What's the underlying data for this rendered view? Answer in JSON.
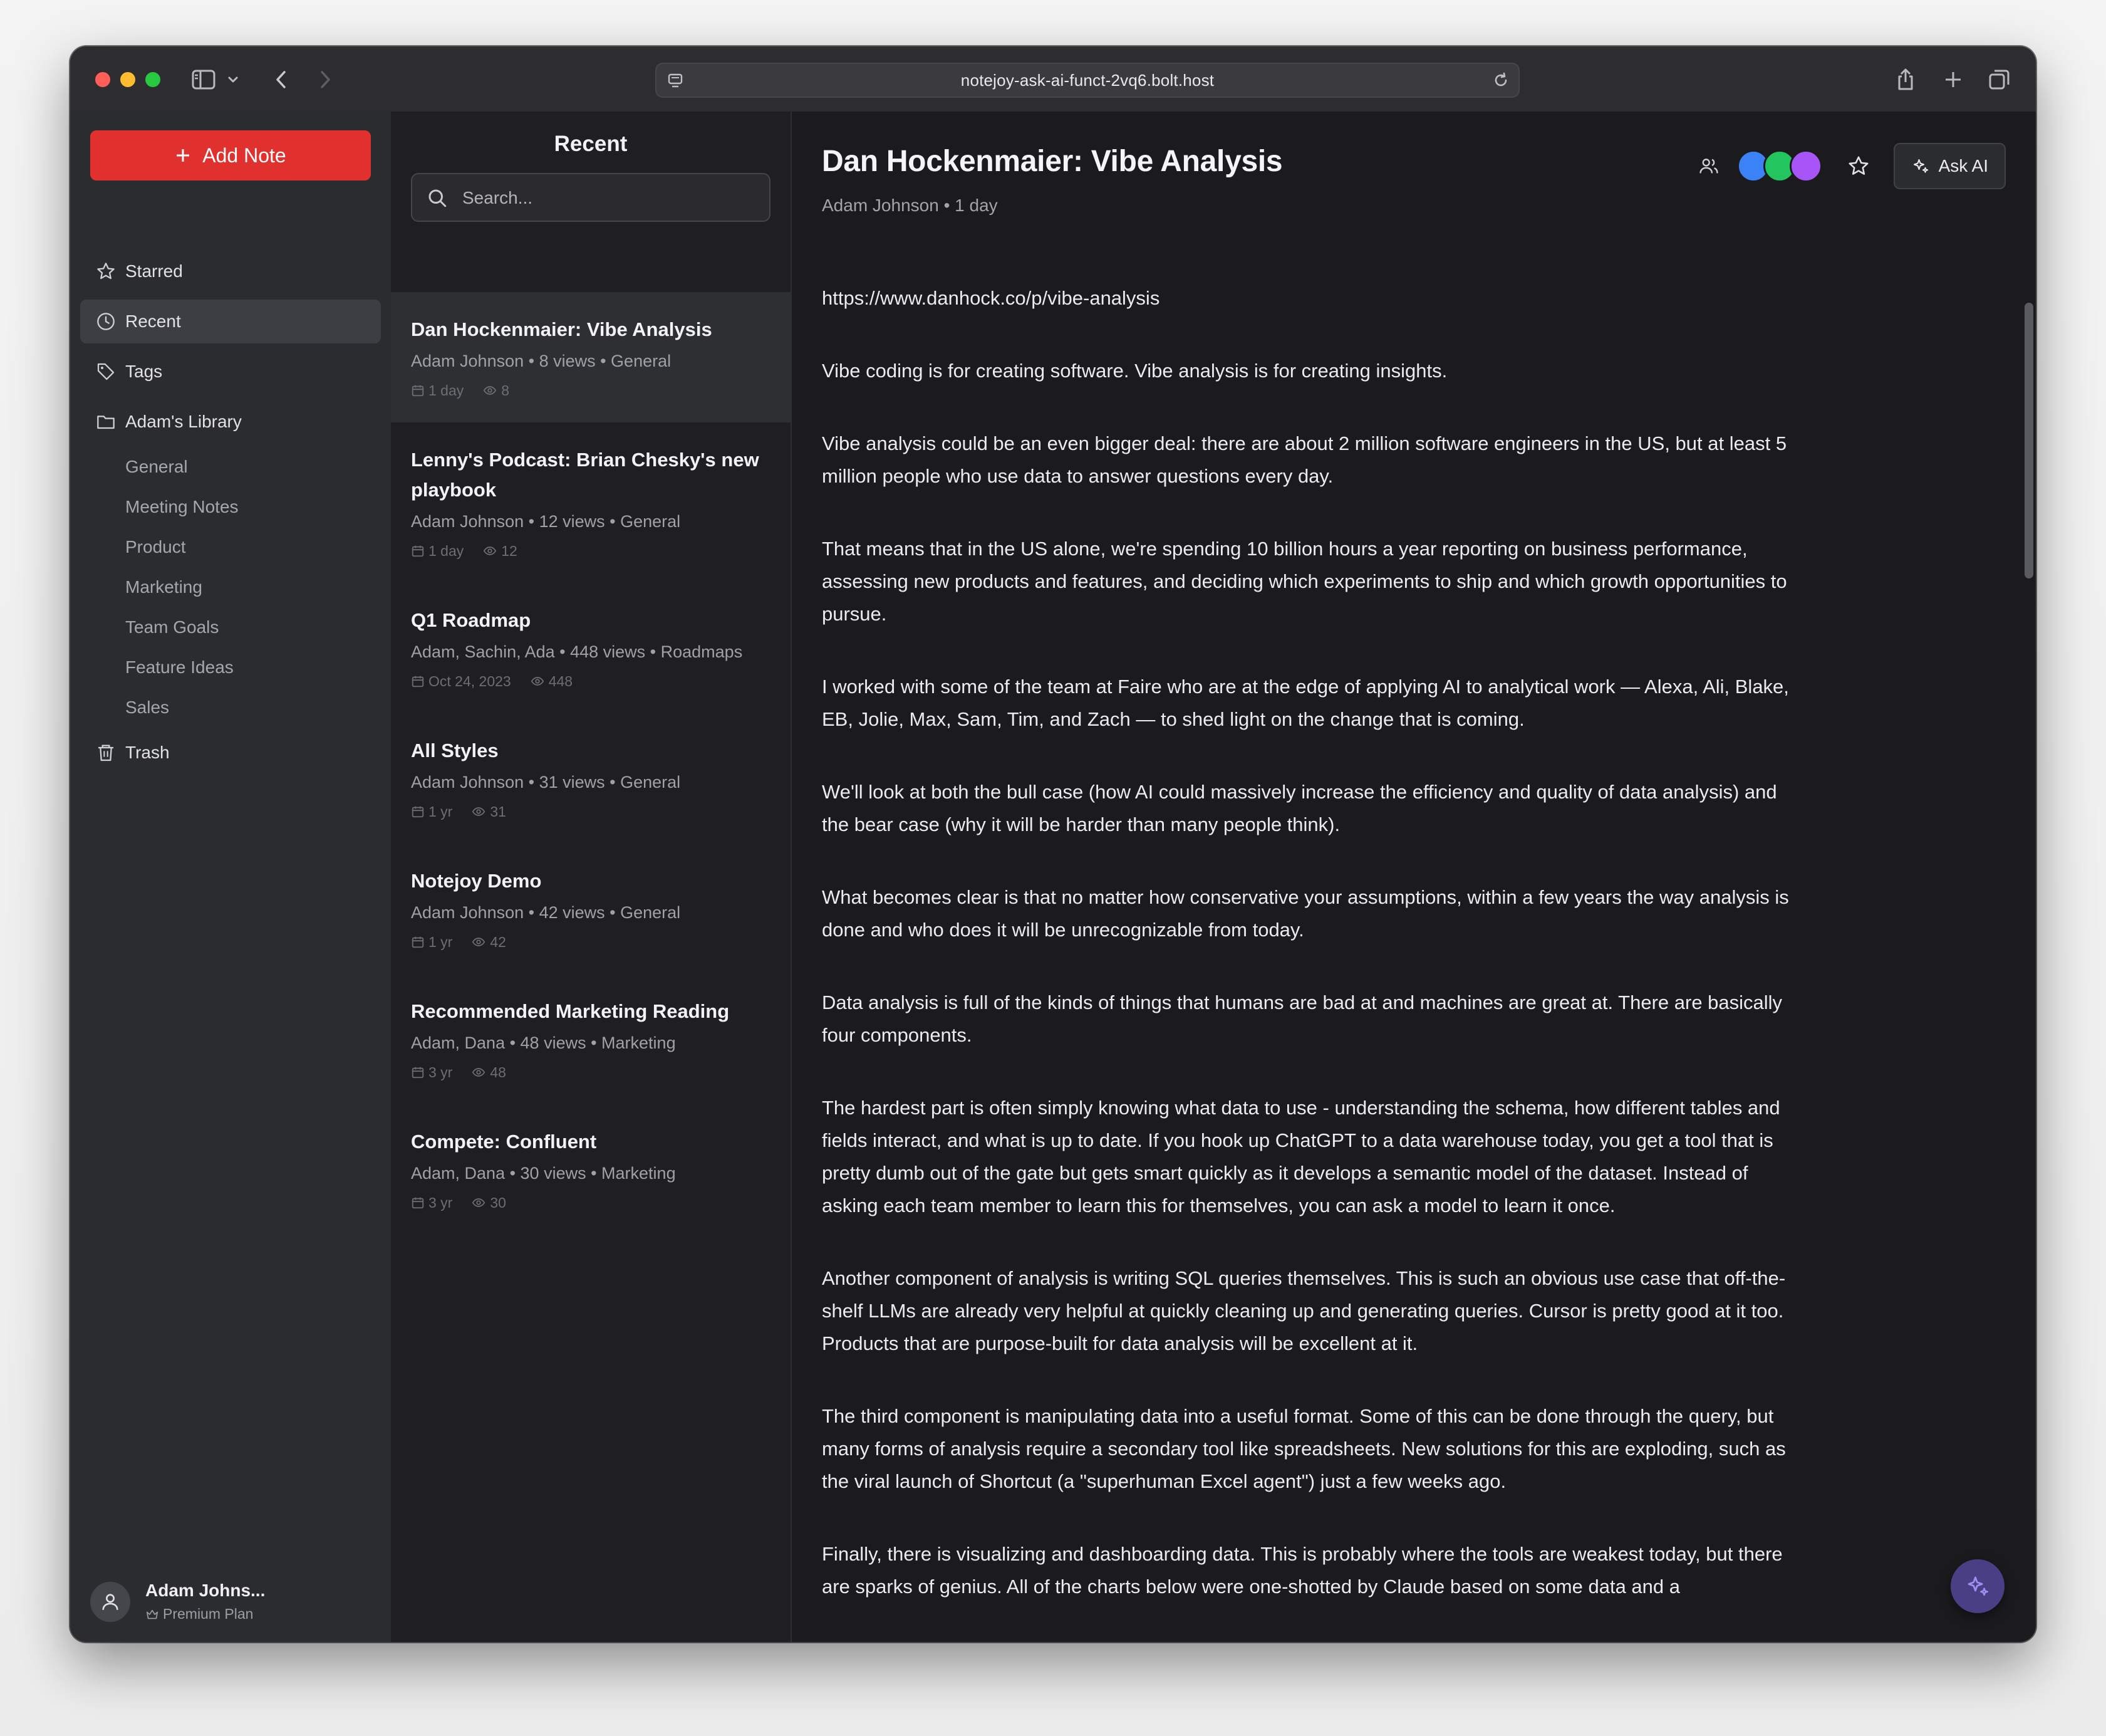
{
  "browser": {
    "url": "notejoy-ask-ai-funct-2vq6.bolt.host"
  },
  "sidebar": {
    "add_note_label": "Add Note",
    "nav": [
      {
        "label": "Starred",
        "icon": "star-icon"
      },
      {
        "label": "Recent",
        "icon": "clock-icon",
        "active": true
      },
      {
        "label": "Tags",
        "icon": "tag-icon"
      },
      {
        "label": "Adam's Library",
        "icon": "folder-icon"
      }
    ],
    "library": [
      "General",
      "Meeting Notes",
      "Product",
      "Marketing",
      "Team Goals",
      "Feature Ideas",
      "Sales"
    ],
    "trash_label": "Trash",
    "user": {
      "name": "Adam Johns...",
      "plan": "Premium Plan"
    }
  },
  "list": {
    "title": "Recent",
    "search_placeholder": "Search...",
    "notes": [
      {
        "title": "Dan Hockenmaier: Vibe Analysis",
        "meta": "Adam Johnson • 8 views • General",
        "age": "1 day",
        "views": "8",
        "selected": true
      },
      {
        "title": "Lenny's Podcast: Brian Chesky's new playbook",
        "meta": "Adam Johnson • 12 views • General",
        "age": "1 day",
        "views": "12"
      },
      {
        "title": "Q1 Roadmap",
        "meta": "Adam, Sachin, Ada • 448 views • Roadmaps",
        "age": "Oct 24, 2023",
        "views": "448"
      },
      {
        "title": "All Styles",
        "meta": "Adam Johnson • 31 views • General",
        "age": "1 yr",
        "views": "31"
      },
      {
        "title": "Notejoy Demo",
        "meta": "Adam Johnson • 42 views • General",
        "age": "1 yr",
        "views": "42"
      },
      {
        "title": "Recommended Marketing Reading",
        "meta": "Adam, Dana • 48 views • Marketing",
        "age": "3 yr",
        "views": "48"
      },
      {
        "title": "Compete: Confluent",
        "meta": "Adam, Dana • 30 views • Marketing",
        "age": "3 yr",
        "views": "30"
      }
    ]
  },
  "editor": {
    "title": "Dan Hockenmaier: Vibe Analysis",
    "meta": "Adam Johnson • 1 day",
    "ask_ai_label": "Ask AI",
    "collaborator_colors": [
      "#3b82f6",
      "#22c55e",
      "#a855f7"
    ],
    "paragraphs": [
      "https://www.danhock.co/p/vibe-analysis",
      "Vibe coding is for creating software. Vibe analysis is for creating insights.",
      "Vibe analysis could be an even bigger deal: there are about 2 million software engineers in the US, but at least 5 million people who use data to answer questions every day.",
      "That means that in the US alone, we're spending 10 billion hours a year reporting on business performance, assessing new products and features, and deciding which experiments to ship and which growth opportunities to pursue.",
      "I worked with some of the team at Faire who are at the edge of applying AI to analytical work — Alexa, Ali, Blake, EB, Jolie, Max, Sam, Tim, and Zach — to shed light on the change that is coming.",
      "We'll look at both the bull case (how AI could massively increase the efficiency and quality of data analysis) and the bear case (why it will be harder than many people think).",
      "What becomes clear is that no matter how conservative your assumptions, within a few years the way analysis is done and who does it will be unrecognizable from today.",
      "Data analysis is full of the kinds of things that humans are bad at and machines are great at. There are basically four components.",
      "The hardest part is often simply knowing what data to use - understanding the schema, how different tables and fields interact, and what is up to date. If you hook up ChatGPT to a data warehouse today, you get a tool that is pretty dumb out of the gate but gets smart quickly as it develops a semantic model of the dataset. Instead of asking each team member to learn this for themselves, you can ask a model to learn it once.",
      "Another component of analysis is writing SQL queries themselves. This is such an obvious use case that off-the-shelf LLMs are already very helpful at quickly cleaning up and generating queries. Cursor is pretty good at it too. Products that are purpose-built for data analysis will be excellent at it.",
      "The third component is manipulating data into a useful format. Some of this can be done through the query, but many forms of analysis require a secondary tool like spreadsheets. New solutions for this are exploding, such as the viral launch of Shortcut (a \"superhuman Excel agent\") just a few weeks ago.",
      "Finally, there is visualizing and dashboarding data. This is probably where the tools are weakest today, but there are sparks of genius. All of the charts below were one-shotted by Claude based on some data and a"
    ]
  }
}
